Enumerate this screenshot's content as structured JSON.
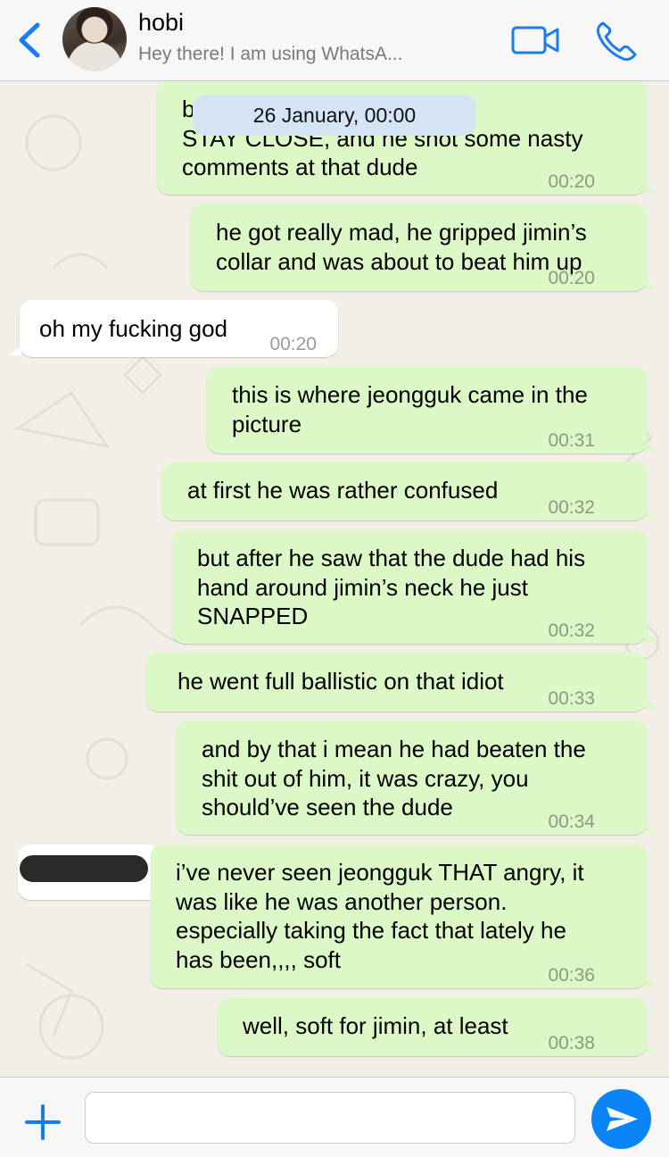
{
  "header": {
    "back_icon": "chevron-left-icon",
    "name": "hobi",
    "status": "Hey there! I am using WhatsA...",
    "video_icon": "video-camera-icon",
    "call_icon": "phone-icon",
    "accent": "#1a7cf2"
  },
  "date_separator": "26 January, 00:00",
  "messages": [
    {
      "dir": "out",
      "text": "b                                couldn’t just\nSTAY CLOSE, and he shot some nasty\ncomments at that dude",
      "time": "00:20"
    },
    {
      "dir": "out",
      "text": "he got really mad, he gripped jimin’s\ncollar and was about to beat him up",
      "time": "00:20"
    },
    {
      "dir": "in",
      "text": "oh my fucking god",
      "time": "00:20"
    },
    {
      "dir": "out",
      "text": "this is where jeongguk came in the\npicture",
      "time": "00:31"
    },
    {
      "dir": "out",
      "text": "at first he was rather confused",
      "time": "00:32"
    },
    {
      "dir": "out",
      "text": "but after he saw that the dude had his\nhand around jimin’s neck he just\nSNAPPED",
      "time": "00:32"
    },
    {
      "dir": "out",
      "text": "he went full ballistic on that idiot",
      "time": "00:33"
    },
    {
      "dir": "out",
      "text": "and by that i mean he had beaten the\nshit out of him, it was crazy, you\nshould’ve seen the dude",
      "time": "00:34"
    },
    {
      "dir": "out",
      "text": "i’ve never seen jeongguk THAT angry, it\nwas like he was another person.\nespecially taking the fact that lately he\nhas been,,,, soft",
      "time": "00:36"
    },
    {
      "dir": "out",
      "text": "well, soft for jimin, at least",
      "time": "00:38"
    }
  ],
  "input": {
    "value": "",
    "plus_icon": "plus-icon",
    "send_icon": "send-arrow-icon",
    "send_color": "#0b84f7"
  },
  "colors": {
    "outgoing_bubble": "#dcf8c6",
    "incoming_bubble": "#ffffff",
    "date_pill": "#d5e4f5"
  }
}
